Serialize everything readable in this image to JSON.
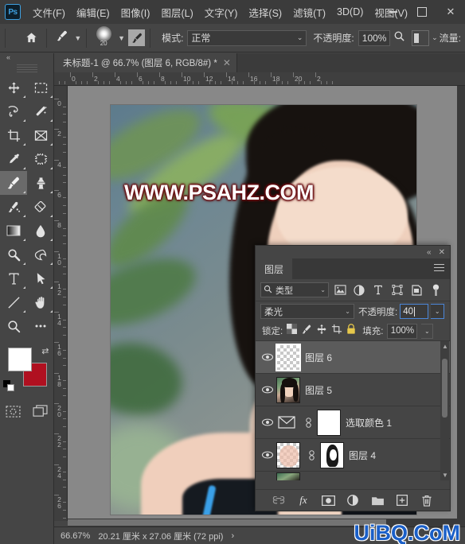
{
  "app": {
    "logo": "Ps",
    "menu": [
      "文件(F)",
      "编辑(E)",
      "图像(I)",
      "图层(L)",
      "文字(Y)",
      "选择(S)",
      "滤镜(T)",
      "3D(D)",
      "视图(V)"
    ],
    "window_controls": {
      "minimize": "minimize-icon",
      "maximize": "maximize-icon",
      "close": "✕"
    }
  },
  "options_bar": {
    "home_icon": "home-icon",
    "tool_icon": "brush-tool-icon",
    "brush_size": "20",
    "airbrush_icon": "airbrush-icon",
    "mode_label": "模式:",
    "mode_value": "正常",
    "opacity_label": "不透明度:",
    "opacity_value": "100%",
    "pressure_icon": "tablet-pressure-icon",
    "flow_label": "流量:"
  },
  "document": {
    "tab_title": "未标题-1 @ 66.7% (图层 6, RGB/8#) *",
    "close_label": "✕",
    "watermark": "WWW.PSAHZ.COM"
  },
  "rulers": {
    "horizontal": [
      "2",
      "0",
      "2",
      "4",
      "6",
      "8",
      "10",
      "12",
      "14",
      "16",
      "18",
      "20",
      "2"
    ],
    "vertical": [
      "0",
      "2",
      "4",
      "6",
      "8",
      "10",
      "12",
      "14",
      "16",
      "18",
      "20",
      "22",
      "24",
      "26"
    ]
  },
  "toolbar": {
    "collapse_icon": "«",
    "tools": [
      {
        "name": "move-tool",
        "icon": "move-icon"
      },
      {
        "name": "marquee-tool",
        "icon": "rectangular-marquee-icon"
      },
      {
        "name": "lasso-tool",
        "icon": "lasso-icon"
      },
      {
        "name": "quick-selection-tool",
        "icon": "magic-wand-icon"
      },
      {
        "name": "crop-tool",
        "icon": "crop-icon"
      },
      {
        "name": "slice-tool",
        "icon": "frame-icon"
      },
      {
        "name": "eyedropper-tool",
        "icon": "eyedropper-icon"
      },
      {
        "name": "patch-tool",
        "icon": "spot-healing-icon"
      },
      {
        "name": "brush-tool",
        "icon": "brush-icon"
      },
      {
        "name": "clone-stamp-tool",
        "icon": "clone-stamp-icon"
      },
      {
        "name": "history-brush-tool",
        "icon": "history-brush-icon"
      },
      {
        "name": "eraser-tool",
        "icon": "eraser-icon"
      },
      {
        "name": "gradient-tool",
        "icon": "gradient-icon"
      },
      {
        "name": "blur-tool",
        "icon": "blur-drop-icon"
      },
      {
        "name": "dodge-tool",
        "icon": "dodge-icon"
      },
      {
        "name": "pen-tool",
        "icon": "pen-icon"
      },
      {
        "name": "type-tool",
        "icon": "type-t-icon"
      },
      {
        "name": "path-selection-tool",
        "icon": "path-arrow-icon"
      },
      {
        "name": "line-tool",
        "icon": "line-icon"
      },
      {
        "name": "hand-tool",
        "icon": "hand-icon"
      },
      {
        "name": "zoom-tool",
        "icon": "magnifier-icon"
      },
      {
        "name": "more-tools",
        "icon": "ellipsis-icon"
      }
    ],
    "active_tool_index": 8,
    "foreground_color": "#ffffff",
    "background_color": "#b01020",
    "swap_icon": "swap-colors-icon",
    "quick_mask_icon": "quick-mask-icon",
    "screen_mode_icon": "screen-mode-icon"
  },
  "layers_panel": {
    "collapse_icon": "«",
    "close_icon": "✕",
    "tab_label": "图层",
    "menu_icon": "panel-menu-icon",
    "filter": {
      "search_icon": "search-icon",
      "type_value": "类型",
      "icons": [
        "pixel-filter-icon",
        "adjustment-filter-icon",
        "type-filter-icon",
        "shape-filter-icon",
        "smart-object-filter-icon",
        "filter-toggle-icon"
      ]
    },
    "blend_mode": "柔光",
    "opacity_label": "不透明度:",
    "opacity_value": "40",
    "lock_label": "锁定:",
    "lock_icons": [
      "lock-transparent-pixels-icon",
      "lock-image-pixels-icon",
      "lock-position-icon",
      "lock-artboard-icon",
      "lock-all-icon"
    ],
    "fill_label": "填充:",
    "fill_value": "100%",
    "layers": [
      {
        "name": "图层 6",
        "visible": true,
        "selected": true,
        "thumb": "transparent",
        "has_mask": false
      },
      {
        "name": "图层 5",
        "visible": true,
        "selected": false,
        "thumb": "photo",
        "has_mask": false
      },
      {
        "name": "选取颜色 1",
        "visible": true,
        "selected": false,
        "thumb": "adjustment",
        "has_mask": true
      },
      {
        "name": "图层 4",
        "visible": true,
        "selected": false,
        "thumb": "skin",
        "has_mask": true
      }
    ],
    "bottom_icons": [
      "link-layers-icon",
      "layer-style-fx-icon",
      "add-mask-icon",
      "adjustment-layer-icon",
      "new-group-icon",
      "new-layer-icon",
      "delete-layer-icon"
    ],
    "fx_label": "fx"
  },
  "status_bar": {
    "zoom": "66.67%",
    "dimensions": "20.21 厘米 x 27.06 厘米 (72 ppi)",
    "expand_icon": "›"
  },
  "overlay_watermark": "UiBQ.CoM",
  "colors": {
    "window_chrome": "#3b3b3b",
    "panel_bg": "#454545",
    "canvas_bg": "#888888",
    "selection_blue": "#4b86d8",
    "watermark_red": "#6b0d12",
    "watermark_blue": "#1a5fc8"
  }
}
